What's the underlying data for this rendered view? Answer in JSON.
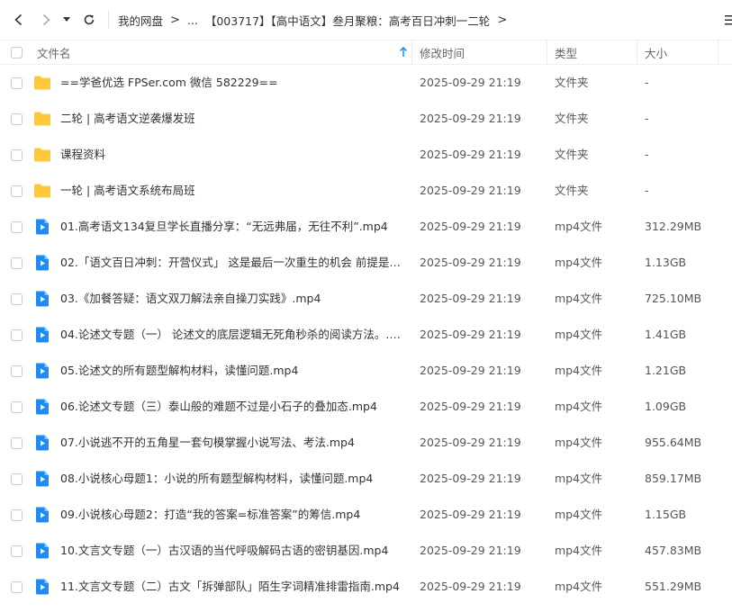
{
  "nav": {
    "breadcrumb": [
      {
        "label": "我的网盘"
      },
      {
        "label": "..."
      },
      {
        "label": "【003717】【高中语文】叁月聚粮：高考百日冲刺一二轮"
      }
    ],
    "separator": ">"
  },
  "header": {
    "name": "文件名",
    "modified": "修改时间",
    "type": "类型",
    "size": "大小",
    "sort_icon": "arrow-up-icon"
  },
  "files": [
    {
      "kind": "folder",
      "name": "==学爸优选 FPSer.com 微信 582229==",
      "date": "2025-09-29 21:19",
      "type": "文件夹",
      "size": "-"
    },
    {
      "kind": "folder",
      "name": "二轮 | 高考语文逆袭爆发班",
      "date": "2025-09-29 21:19",
      "type": "文件夹",
      "size": "-"
    },
    {
      "kind": "folder",
      "name": "课程资料",
      "date": "2025-09-29 21:19",
      "type": "文件夹",
      "size": "-"
    },
    {
      "kind": "folder",
      "name": "一轮 | 高考语文系统布局班",
      "date": "2025-09-29 21:19",
      "type": "文件夹",
      "size": "-"
    },
    {
      "kind": "video",
      "name": "01.高考语文134复旦学长直播分享：“无远弗届，无往不利”.mp4",
      "date": "2025-09-29 21:19",
      "type": "mp4文件",
      "size": "312.29MB"
    },
    {
      "kind": "video",
      "name": "02.「语文百日冲刺：开营仪式」 这是最后一次重生的机会 前提是效...",
      "date": "2025-09-29 21:19",
      "type": "mp4文件",
      "size": "1.13GB"
    },
    {
      "kind": "video",
      "name": "03.《加餐答疑：语文双刀解法亲自操刀实践》.mp4",
      "date": "2025-09-29 21:19",
      "type": "mp4文件",
      "size": "725.10MB"
    },
    {
      "kind": "video",
      "name": "04.论述文专题（一） 论述文的底层逻辑无死角秒杀的阅读方法。.mp4",
      "date": "2025-09-29 21:19",
      "type": "mp4文件",
      "size": "1.41GB"
    },
    {
      "kind": "video",
      "name": "05.论述文的所有题型解构材料，读懂问题.mp4",
      "date": "2025-09-29 21:19",
      "type": "mp4文件",
      "size": "1.21GB"
    },
    {
      "kind": "video",
      "name": "06.论述文专题（三）泰山般的难题不过是小石子的叠加态.mp4",
      "date": "2025-09-29 21:19",
      "type": "mp4文件",
      "size": "1.09GB"
    },
    {
      "kind": "video",
      "name": "07.小说逃不开的五角星一套句模掌握小说写法、考法.mp4",
      "date": "2025-09-29 21:19",
      "type": "mp4文件",
      "size": "955.64MB"
    },
    {
      "kind": "video",
      "name": "08.小说核心母题1：小说的所有题型解构材料，读懂问题.mp4",
      "date": "2025-09-29 21:19",
      "type": "mp4文件",
      "size": "859.17MB"
    },
    {
      "kind": "video",
      "name": "09.小说核心母题2：打造“我的答案=标准答案”的筹信.mp4",
      "date": "2025-09-29 21:19",
      "type": "mp4文件",
      "size": "1.15GB"
    },
    {
      "kind": "video",
      "name": "10.文言文专题（一）古汉语的当代呼吸解码古语的密钥基因.mp4",
      "date": "2025-09-29 21:19",
      "type": "mp4文件",
      "size": "457.83MB"
    },
    {
      "kind": "video",
      "name": "11.文言文专题（二）古文「拆弹部队」陌生字词精准排雷指南.mp4",
      "date": "2025-09-29 21:19",
      "type": "mp4文件",
      "size": "551.29MB"
    }
  ],
  "colors": {
    "folder": "#FFC83D",
    "video": "#1E8CF0",
    "sort_arrow": "#1E8CF0"
  }
}
